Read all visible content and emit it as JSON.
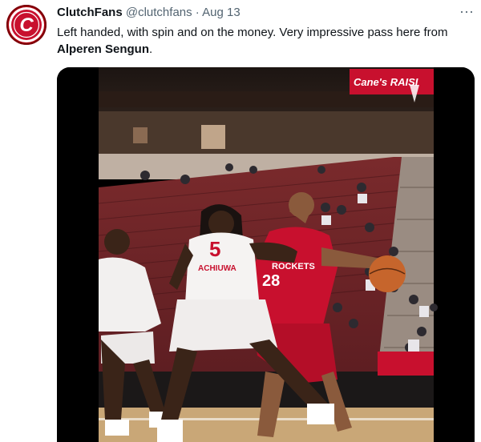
{
  "tweet": {
    "display_name": "ClutchFans",
    "handle": "@clutchfans",
    "separator": "·",
    "date": "Aug 13",
    "more_label": "···",
    "text_prefix": "Left handed, with spin and on the money. Very impressive pass here from ",
    "text_name": "Alperen Sengun",
    "text_suffix": "."
  },
  "avatar": {
    "letter": "C",
    "icon": "clutchfans-logo-icon"
  },
  "media": {
    "banner_text": "Cane's RAISI",
    "jersey_white_number": "5",
    "jersey_white_name": "ACHIUWA",
    "jersey_red_number": "28",
    "jersey_red_team": "ROCKETS"
  },
  "colors": {
    "brand_red": "#b3000f",
    "rocket_red": "#c8102e",
    "text_secondary": "#536471"
  }
}
